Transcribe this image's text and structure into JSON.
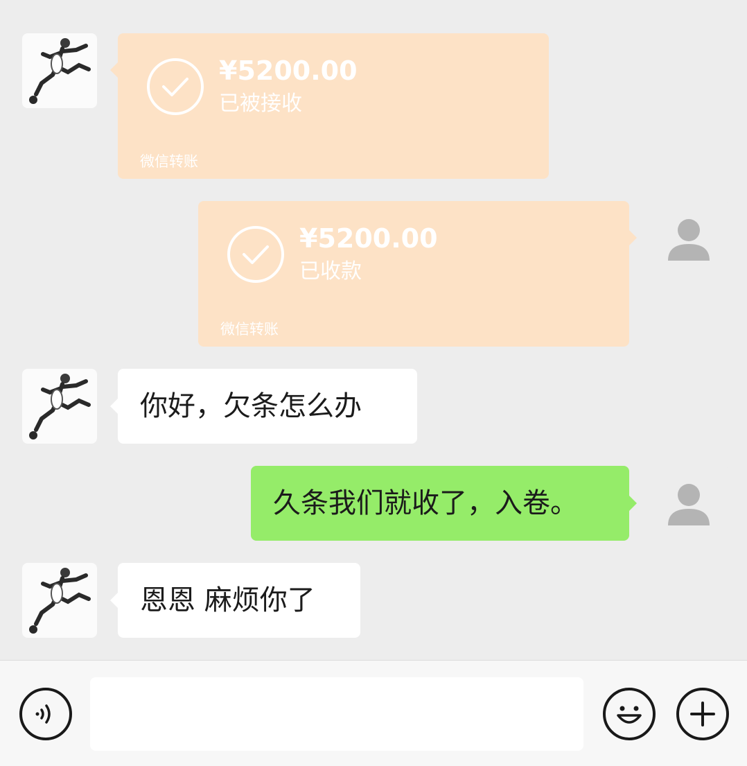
{
  "messages": [
    {
      "sender": "contact",
      "type": "transfer",
      "amount": "¥5200.00",
      "status": "已被接收",
      "label": "微信转账"
    },
    {
      "sender": "me",
      "type": "transfer",
      "amount": "¥5200.00",
      "status": "已收款",
      "label": "微信转账"
    },
    {
      "sender": "contact",
      "type": "text",
      "text": "你好，欠条怎么办"
    },
    {
      "sender": "me",
      "type": "text",
      "text": "久条我们就收了，入卷。"
    },
    {
      "sender": "contact",
      "type": "text",
      "text": "恩恩 麻烦你了"
    }
  ],
  "colors": {
    "background": "#ededed",
    "transfer_bubble": "#fde2c6",
    "sent_bubble": "#95ec69",
    "received_bubble": "#ffffff"
  },
  "input_bar": {
    "input_value": "",
    "icons": [
      "voice-icon",
      "emoji-icon",
      "plus-icon"
    ]
  }
}
